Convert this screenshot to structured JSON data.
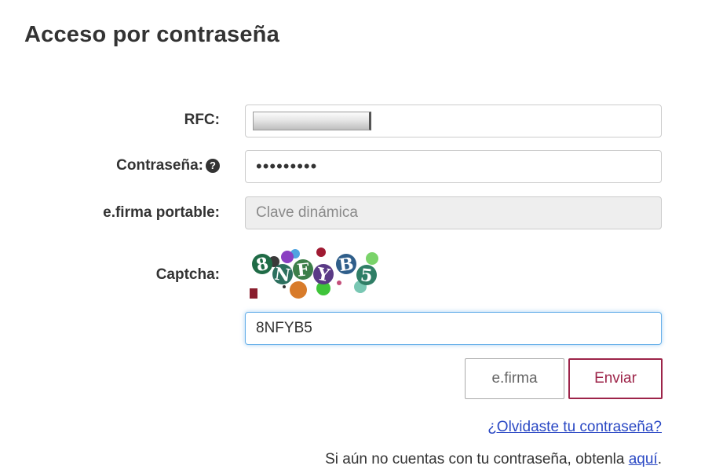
{
  "page": {
    "title": "Acceso por contraseña"
  },
  "form": {
    "rfc": {
      "label": "RFC:",
      "value": ""
    },
    "password": {
      "label": "Contraseña:",
      "value": "•••••••••",
      "help_icon": "question-circle-icon"
    },
    "efirma_portable": {
      "label": "e.firma portable:",
      "placeholder": "Clave dinámica"
    },
    "captcha": {
      "label": "Captcha:",
      "image_text": "8NFYB5",
      "value": "8NFYB5"
    }
  },
  "buttons": {
    "efirma": "e.firma",
    "enviar": "Enviar"
  },
  "links": {
    "forgot_password": "¿Olvidaste tu contraseña?",
    "signup_prefix": "Si aún no cuentas con tu contraseña, obtenla ",
    "signup_link": "aquí",
    "signup_suffix": "."
  },
  "colors": {
    "accent": "#9d2449",
    "link": "#2a48c4",
    "focus": "#66afe9",
    "disabled_bg": "#eeeeee"
  }
}
